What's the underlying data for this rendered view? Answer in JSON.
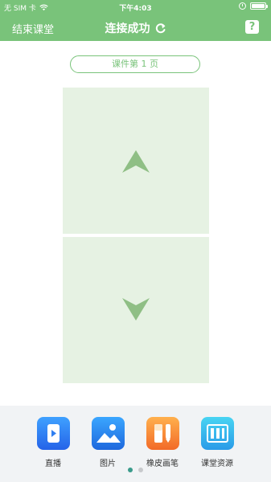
{
  "status_bar": {
    "carrier": "无 SIM 卡",
    "time": "下午4:03"
  },
  "nav": {
    "left_label": "结束课堂",
    "title": "连接成功",
    "help_label": "?"
  },
  "page_indicator": "课件第 1 页",
  "toolbar": {
    "items": [
      {
        "label": "直播",
        "icon": "live-icon"
      },
      {
        "label": "图片",
        "icon": "picture-icon"
      },
      {
        "label": "橡皮画笔",
        "icon": "eraser-pen-icon"
      },
      {
        "label": "课堂资源",
        "icon": "resource-icon"
      }
    ],
    "pages": 2,
    "active_page": 1
  },
  "colors": {
    "primary": "#79c37a",
    "panel": "#e6f2e3",
    "arrow": "#8fbf85"
  }
}
